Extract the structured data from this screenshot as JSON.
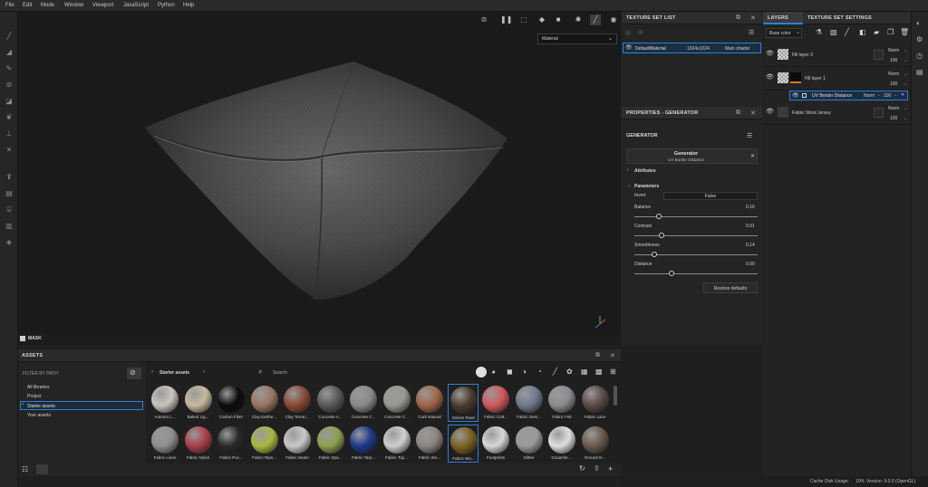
{
  "menu": [
    "File",
    "Edit",
    "Mode",
    "Window",
    "Viewport",
    "JavaScript",
    "Python",
    "Help"
  ],
  "viewport": {
    "material_select": "Material",
    "mask_label": "MASK"
  },
  "texture_set_list": {
    "title": "TEXTURE SET LIST",
    "row": {
      "name": "DefaultMaterial",
      "size": "1024x1024",
      "shader": "Main shader"
    }
  },
  "properties": {
    "title": "PROPERTIES - GENERATOR",
    "section": "GENERATOR",
    "generator_title": "Generator",
    "generator_sub": "UV Border Distance",
    "attributes_label": "Attributes",
    "parameters_label": "Parameters",
    "invert_label": "Invert",
    "invert_value": "False",
    "params": [
      {
        "label": "Balance",
        "value": "0.16",
        "fraction": 0.2
      },
      {
        "label": "Contrast",
        "value": "0.01",
        "fraction": 0.22
      },
      {
        "label": "Smoothness",
        "value": "0.14",
        "fraction": 0.16
      },
      {
        "label": "Distance",
        "value": "0.09",
        "fraction": 0.3
      }
    ],
    "restore_label": "Restore defaults"
  },
  "layers": {
    "tab_layers": "LAYERS",
    "tab_settings": "TEXTURE SET SETTINGS",
    "channel_select": "Base color",
    "items": [
      {
        "name": "Fill layer 3",
        "blend": "Norm",
        "opacity": "100"
      },
      {
        "name": "Fill layer 1",
        "blend": "Norm",
        "opacity": "100"
      },
      {
        "name": "UV Border Distance",
        "blend": "Norm",
        "opacity": "100"
      },
      {
        "name": "Fabric Wool Jersey",
        "blend": "Norm",
        "opacity": "100"
      }
    ]
  },
  "assets": {
    "title": "ASSETS",
    "filter_label": "FILTER BY PATH",
    "tree": [
      "All libraries",
      "Project",
      "Starter assets",
      "Your assets"
    ],
    "breadcrumb": "Starter assets",
    "search_placeholder": "Search",
    "row1": [
      {
        "name": "Autumn L...",
        "color": "#c9c4bd"
      },
      {
        "name": "Baked Lig...",
        "color": "#c8b9a0"
      },
      {
        "name": "Carbon Fiber",
        "color": "#0c0c0c"
      },
      {
        "name": "Clay Earthe...",
        "color": "#9b7560"
      },
      {
        "name": "Clay Terrac...",
        "color": "#8a4a35"
      },
      {
        "name": "Concrete A...",
        "color": "#5a5a5c"
      },
      {
        "name": "Concrete C...",
        "color": "#8a8a8a"
      },
      {
        "name": "Concrete C...",
        "color": "#9a9891"
      },
      {
        "name": "Cork Natural",
        "color": "#a0664a"
      },
      {
        "name": "Denim Rivet",
        "color": "#4a3a2a"
      },
      {
        "name": "Fabric Cott...",
        "color": "#d0585e"
      },
      {
        "name": "Fabric Deni...",
        "color": "#6f7a8e"
      },
      {
        "name": "Fabric Felt",
        "color": "#8a8c90"
      },
      {
        "name": "Fabric Lace",
        "color": "#5a4a45"
      }
    ],
    "row2": [
      {
        "name": "Fabric Linen",
        "color": "#8f8f8f"
      },
      {
        "name": "Fabric Nylon",
        "color": "#a8404a"
      },
      {
        "name": "Fabric Puc...",
        "color": "#2a2a2a"
      },
      {
        "name": "Fabric Rips...",
        "color": "#aab842"
      },
      {
        "name": "Fabric Seam",
        "color": "#c8c8c8"
      },
      {
        "name": "Fabric Spa...",
        "color": "#8aa050"
      },
      {
        "name": "Fabric Tarp...",
        "color": "#1f3a8c"
      },
      {
        "name": "Fabric Top...",
        "color": "#cfcfcf"
      },
      {
        "name": "Fabric Wo...",
        "color": "#8c8680"
      },
      {
        "name": "Fabric Wo...",
        "color": "#7a6020"
      },
      {
        "name": "Footprints",
        "color": "#d8d8d8"
      },
      {
        "name": "Glitter",
        "color": "#9a9a9a"
      },
      {
        "name": "Gouache ...",
        "color": "#e0e0e0"
      },
      {
        "name": "Ground N...",
        "color": "#6a5a4a"
      }
    ]
  },
  "status": {
    "cache": "Cache Disk Usage:",
    "cache_value": "10%",
    "version": "Version: 9.0.0 (OpenGL)"
  },
  "colors": {
    "accent": "#2d7fd8",
    "panel": "#242424",
    "header": "#2d2d2d"
  }
}
